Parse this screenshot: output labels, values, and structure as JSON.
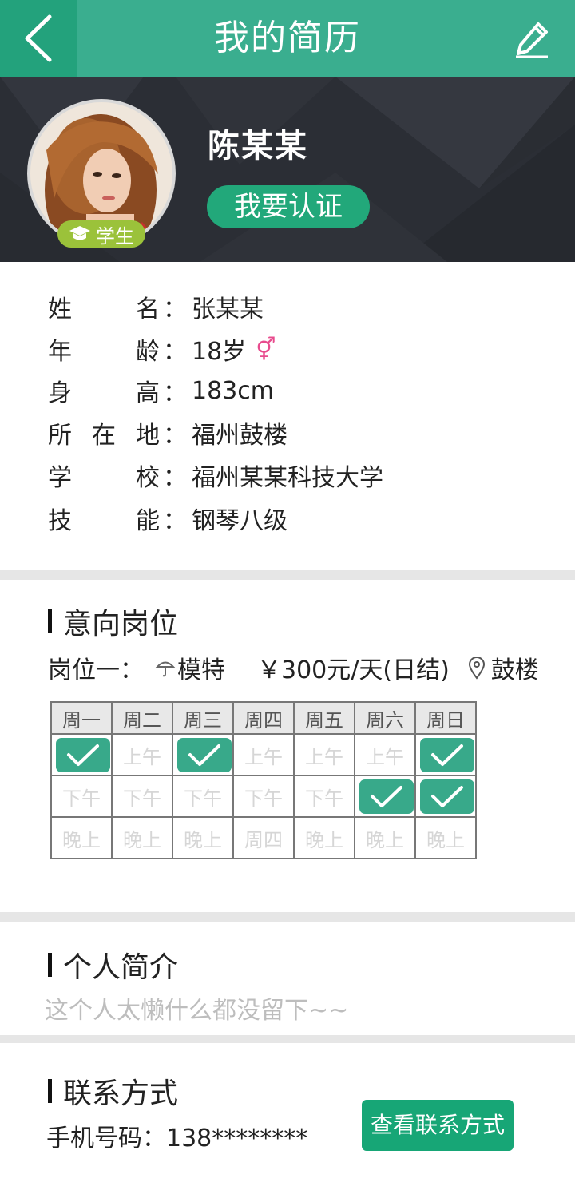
{
  "header": {
    "title": "我的简历"
  },
  "profile": {
    "name": "陈某某",
    "badge": "学生",
    "cert_button": "我要认证"
  },
  "info": [
    {
      "label": [
        "姓",
        "名"
      ],
      "value": "张某某"
    },
    {
      "label": [
        "年",
        "龄"
      ],
      "value": "18岁"
    },
    {
      "label": [
        "身",
        "高"
      ],
      "value": "183cm"
    },
    {
      "label": [
        "所",
        "在",
        "地"
      ],
      "value": "福州鼓楼"
    },
    {
      "label": [
        "学",
        "校"
      ],
      "value": "福州某某科技大学"
    },
    {
      "label": [
        "技",
        "能"
      ],
      "value": "钢琴八级"
    }
  ],
  "gender_symbol": "⚥",
  "colon": "：",
  "intent": {
    "title": "意向岗位",
    "job_label": "岗位一：",
    "job_name": "模特",
    "salary": "￥300元/天(日结)",
    "location": "鼓楼",
    "days": [
      "周一",
      "周二",
      "周三",
      "周四",
      "周五",
      "周六",
      "周日"
    ],
    "rows": [
      [
        "上午",
        "上午",
        "上午",
        "上午",
        "上午",
        "上午",
        "上午"
      ],
      [
        "下午",
        "下午",
        "下午",
        "下午",
        "下午",
        "下午",
        "下午"
      ],
      [
        "晚上",
        "晚上",
        "晚上",
        "周四",
        "晚上",
        "晚上",
        "晚上"
      ]
    ],
    "selected": [
      [
        true,
        false,
        true,
        false,
        false,
        false,
        true
      ],
      [
        false,
        false,
        false,
        false,
        false,
        true,
        true
      ],
      [
        false,
        false,
        false,
        false,
        false,
        false,
        false
      ]
    ]
  },
  "bio": {
    "title": "个人简介",
    "text": "这个人太懒什么都没留下~~"
  },
  "contact": {
    "title": "联系方式",
    "phone": "手机号码：138********",
    "button": "查看联系方式"
  },
  "colors": {
    "primary": "#3aae8f",
    "dark_green": "#23a27c",
    "button_green": "#17a676",
    "badge_green": "#9bc23a",
    "banner_bg": "#2c2f36",
    "gender_pink": "#e84c8e"
  }
}
